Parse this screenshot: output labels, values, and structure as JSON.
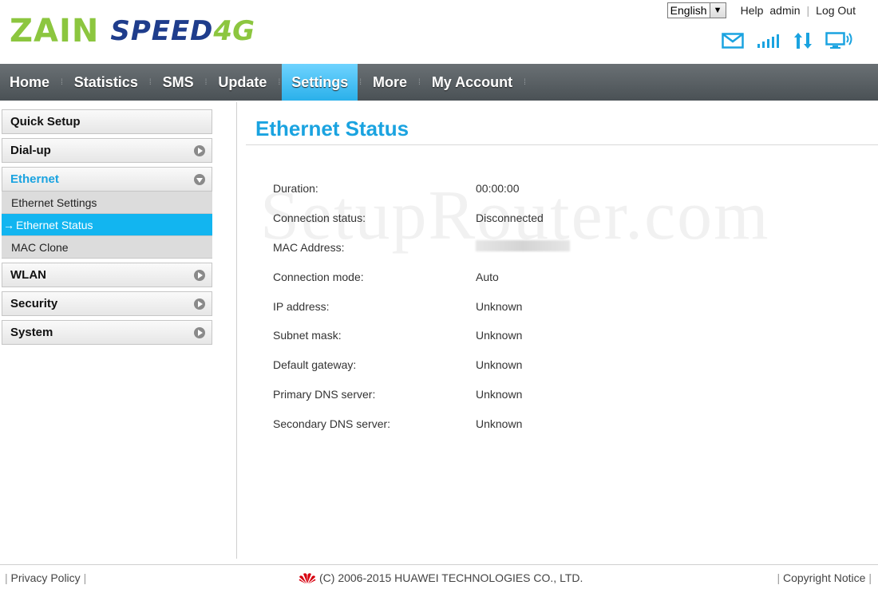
{
  "brand": {
    "zain": "ZAIN",
    "speed": "SPEED",
    "fourg": "4G"
  },
  "top_links": {
    "language": "English",
    "help": "Help",
    "user": "admin",
    "logout": "Log Out"
  },
  "nav": {
    "items": [
      {
        "label": "Home"
      },
      {
        "label": "Statistics"
      },
      {
        "label": "SMS"
      },
      {
        "label": "Update"
      },
      {
        "label": "Settings"
      },
      {
        "label": "More"
      },
      {
        "label": "My Account"
      }
    ],
    "active": "Settings"
  },
  "sidebar": {
    "quick_setup": "Quick Setup",
    "dialup": "Dial-up",
    "ethernet": "Ethernet",
    "ethernet_sub": [
      "Ethernet Settings",
      "Ethernet Status",
      "MAC Clone"
    ],
    "wlan": "WLAN",
    "security": "Security",
    "system": "System"
  },
  "main": {
    "title": "Ethernet Status",
    "watermark": "SetupRouter.com",
    "rows": [
      {
        "label": "Duration:",
        "value": "00:00:00"
      },
      {
        "label": "Connection status:",
        "value": "Disconnected"
      },
      {
        "label": "MAC Address:",
        "value": ""
      },
      {
        "label": "Connection mode:",
        "value": "Auto"
      },
      {
        "label": "IP address:",
        "value": "Unknown"
      },
      {
        "label": "Subnet mask:",
        "value": "Unknown"
      },
      {
        "label": "Default gateway:",
        "value": "Unknown"
      },
      {
        "label": "Primary DNS server:",
        "value": "Unknown"
      },
      {
        "label": "Secondary DNS server:",
        "value": "Unknown"
      }
    ]
  },
  "footer": {
    "privacy": "Privacy Policy",
    "copyright": "(C) 2006-2015 HUAWEI TECHNOLOGIES CO., LTD.",
    "notice": "Copyright Notice"
  },
  "colors": {
    "accent": "#1aa3e0",
    "brand_green": "#8cc63f",
    "brand_blue": "#1f3d8c",
    "nav_bg": "#565d61",
    "huawei_red": "#d7000f"
  }
}
